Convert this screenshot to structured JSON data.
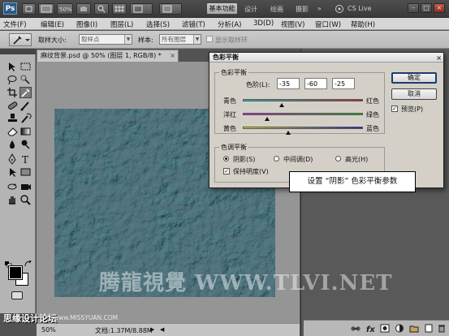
{
  "app": {
    "logo": "Ps",
    "workspace_active": "基本功能",
    "workspace_items": [
      "设计",
      "绘画",
      "摄影"
    ],
    "cs_live": "CS Live",
    "more": "»"
  },
  "menu": [
    "文件(F)",
    "编辑(E)",
    "图像(I)",
    "图层(L)",
    "选择(S)",
    "滤镜(T)",
    "分析(A)",
    "3D(D)",
    "视图(V)",
    "窗口(W)",
    "帮助(H)"
  ],
  "options": {
    "sample_size_label": "取样大小:",
    "sample_size_value": "取样点",
    "sample_label": "样本:",
    "sample_value": "所有图层",
    "show_ring_label": "显示取样环"
  },
  "document": {
    "tab_title": "麻纹背景.psd @ 50% (图层 1, RGB/8) *",
    "zoom": "50%",
    "doc_info": "文档:1.37M/8.88M"
  },
  "dialog": {
    "title": "色彩平衡",
    "balance_group": "色彩平衡",
    "levels_label": "色阶(L):",
    "levels": [
      "-35",
      "-60",
      "-25"
    ],
    "sliders": [
      {
        "left": "青色",
        "right": "红色",
        "value": -35,
        "left_color": "#00c8d8",
        "right_color": "#e01b1b"
      },
      {
        "left": "洋红",
        "right": "绿色",
        "value": -60,
        "left_color": "#d81bd8",
        "right_color": "#18b818"
      },
      {
        "left": "黄色",
        "right": "蓝色",
        "value": -25,
        "left_color": "#e8e000",
        "right_color": "#1c1cd8"
      }
    ],
    "tone_group": "色调平衡",
    "tones": [
      "阴影(S)",
      "中间调(D)",
      "高光(H)"
    ],
    "tone_selected": 0,
    "preserve_luminosity": "保持明度(V)",
    "ok": "确定",
    "cancel": "取消",
    "preview": "预览(P)"
  },
  "callout": "设置 “阴影” 色彩平衡参数",
  "watermarks": {
    "big": "腾龍視覺 WWW.TLVI.NET",
    "corner": "思缘设计论坛",
    "small": "www.MISSYUAN.COM"
  }
}
